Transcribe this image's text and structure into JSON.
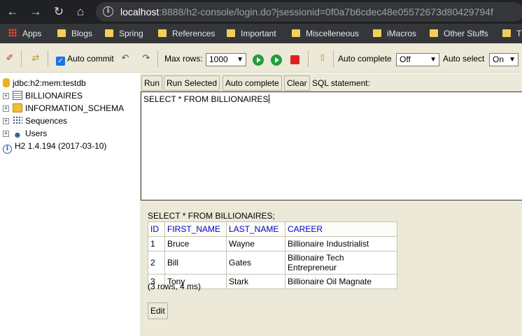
{
  "browser": {
    "url_host": "localhost",
    "url_rest": ":8888/h2-console/login.do?jsessionid=0f0a7b6cdec48e05572673d80429794f",
    "bookmarks": [
      "Apps",
      "Blogs",
      "Spring",
      "References",
      "Important",
      "Miscelleneous",
      "iMacros",
      "Other Stuffs",
      "Th"
    ]
  },
  "toolbar": {
    "auto_commit_label": "Auto commit",
    "max_rows_label": "Max rows:",
    "max_rows_value": "1000",
    "auto_complete_label": "Auto complete",
    "auto_complete_value": "Off",
    "auto_select_label": "Auto select",
    "auto_select_value": "On"
  },
  "tree": {
    "connection": "jdbc:h2:mem:testdb",
    "items": [
      "BILLIONAIRES",
      "INFORMATION_SCHEMA",
      "Sequences",
      "Users"
    ],
    "version": "H2 1.4.194 (2017-03-10)"
  },
  "query": {
    "buttons": [
      "Run",
      "Run Selected",
      "Auto complete",
      "Clear"
    ],
    "sql_label": "SQL statement:",
    "sql_text": "SELECT * FROM BILLIONAIRES"
  },
  "result": {
    "title": "SELECT * FROM BILLIONAIRES;",
    "columns": [
      "ID",
      "FIRST_NAME",
      "LAST_NAME",
      "CAREER"
    ],
    "rows": [
      [
        "1",
        "Bruce",
        "Wayne",
        "Billionaire Industrialist"
      ],
      [
        "2",
        "Bill",
        "Gates",
        "Billionaire Tech Entrepreneur"
      ],
      [
        "3",
        "Tony",
        "Stark",
        "Billionaire Oil Magnate"
      ]
    ],
    "row_count": "(3 rows, 4 ms)",
    "edit_label": "Edit"
  }
}
